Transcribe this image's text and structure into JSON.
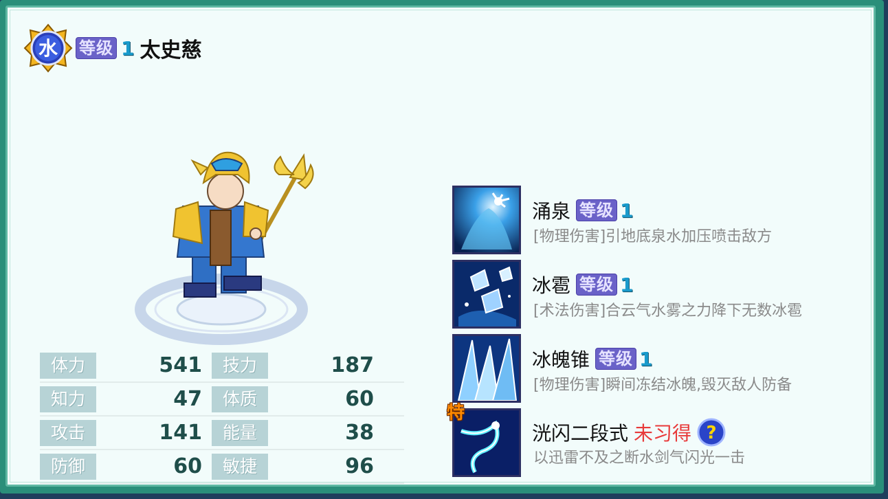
{
  "hero": {
    "element": "水",
    "level_label": "等级",
    "level": "1",
    "name": "太史慈"
  },
  "stats": [
    {
      "label": "体力",
      "value": "541",
      "label2": "技力",
      "value2": "187"
    },
    {
      "label": "知力",
      "value": "47",
      "label2": "体质",
      "value2": "60"
    },
    {
      "label": "攻击",
      "value": "141",
      "label2": "能量",
      "value2": "38"
    },
    {
      "label": "防御",
      "value": "60",
      "label2": "敏捷",
      "value2": "96"
    }
  ],
  "skills": [
    {
      "name": "涌泉",
      "level_label": "等级",
      "level": "1",
      "desc": "[物理伤害]引地底泉水加压喷击敌方",
      "icon": "water-spout-icon"
    },
    {
      "name": "冰雹",
      "level_label": "等级",
      "level": "1",
      "desc": "[术法伤害]合云气水雾之力降下无数冰雹",
      "icon": "hail-icon"
    },
    {
      "name": "冰魄锥",
      "level_label": "等级",
      "level": "1",
      "desc": "[物理伤害]瞬间冻结冰魄,毁灭敌人防备",
      "icon": "ice-cone-icon"
    },
    {
      "name": "洸闪二段式",
      "status": "未习得",
      "special": "特",
      "desc": "以迅雷不及之断水剑气闪光一击",
      "icon": "sword-flash-icon"
    }
  ],
  "colors": {
    "frame": "#2a8f7a",
    "panel": "#f2fcfb",
    "stat_label_bg": "#b7d3d6",
    "level_tag": "#6a62c8",
    "not_learned": "#e83a3a"
  }
}
